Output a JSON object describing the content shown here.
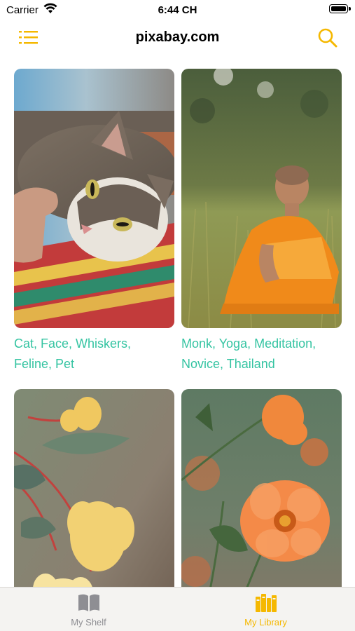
{
  "status_bar": {
    "carrier": "Carrier",
    "time": "6:44 CH"
  },
  "nav": {
    "title": "pixabay.com"
  },
  "accent_color": "#f5b800",
  "caption_color": "#35c4a2",
  "grid": {
    "items": [
      {
        "caption_line1": "Cat, Face, Whiskers,",
        "caption_line2": "Feline, Pet"
      },
      {
        "caption_line1": "Monk, Yoga, Meditation,",
        "caption_line2": "Novice, Thailand"
      },
      {
        "caption_line1": "",
        "caption_line2": ""
      },
      {
        "caption_line1": "",
        "caption_line2": ""
      }
    ]
  },
  "tab_bar": {
    "tabs": [
      {
        "label": "My Shelf",
        "icon": "book-open-icon",
        "selected": false
      },
      {
        "label": "My Library",
        "icon": "books-icon",
        "selected": true
      }
    ]
  }
}
